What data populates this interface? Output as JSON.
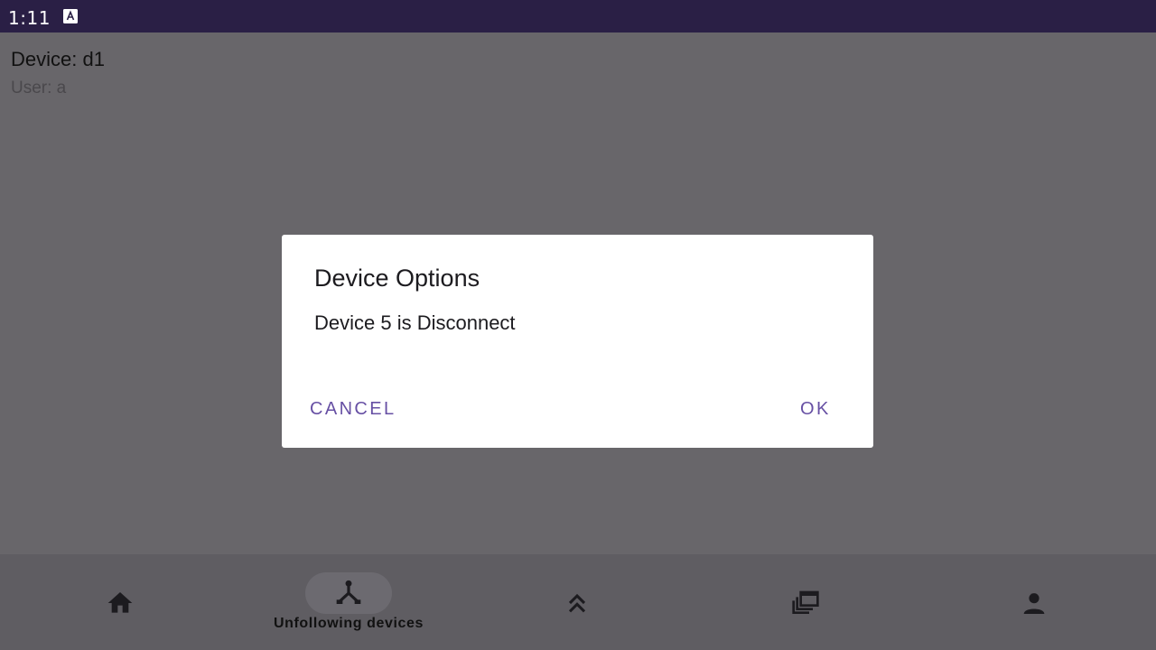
{
  "status_bar": {
    "time": "1:11",
    "notification_icon": "accessibility-text-icon"
  },
  "content": {
    "device_title": "Device: d1",
    "user_line": "User: a"
  },
  "dialog": {
    "title": "Device Options",
    "message": "Device 5 is Disconnect",
    "cancel_label": "CANCEL",
    "ok_label": "OK",
    "accent_color": "#6750a4"
  },
  "bottom_nav": {
    "items": [
      {
        "icon": "home-icon",
        "label": ""
      },
      {
        "icon": "fork-network-icon",
        "label": "Unfollowing devices",
        "active": true
      },
      {
        "icon": "double-chevron-up-icon",
        "label": ""
      },
      {
        "icon": "stacked-windows-icon",
        "label": ""
      },
      {
        "icon": "person-icon",
        "label": ""
      }
    ]
  },
  "colors": {
    "status_bar": "#2a1f45",
    "scrim_background": "#68666a",
    "bottom_nav": "#5f5d62"
  }
}
